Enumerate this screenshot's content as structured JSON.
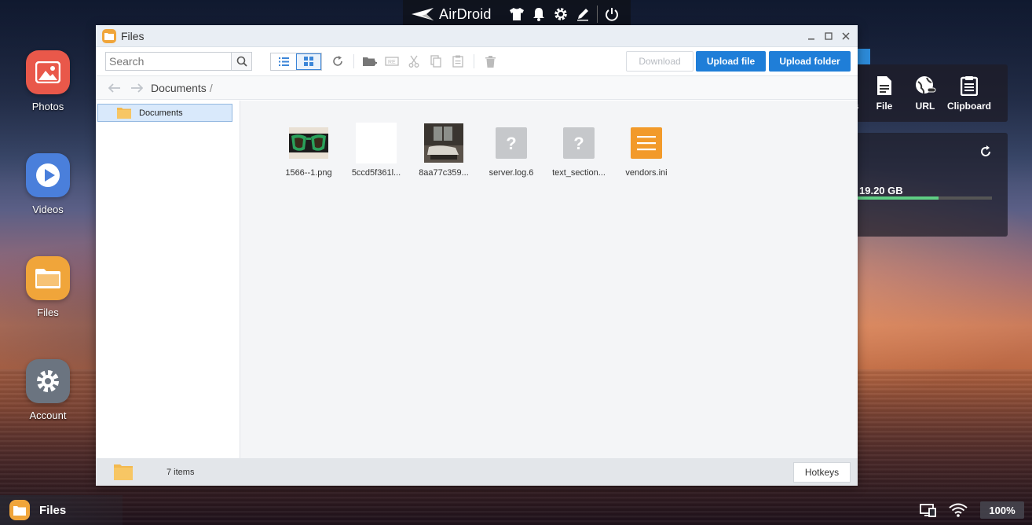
{
  "topbar": {
    "brand": "AirDroid",
    "icons": [
      "tshirt-icon",
      "bell-icon",
      "gear-icon",
      "pen-icon",
      "power-icon"
    ]
  },
  "desktop": {
    "icons": [
      {
        "label": "Photos",
        "icon": "photos-icon",
        "color": "#e9584a"
      },
      {
        "label": "Videos",
        "icon": "videos-icon",
        "color": "#4a7fdb"
      },
      {
        "label": "Files",
        "icon": "files-icon",
        "color": "#f0a53a"
      },
      {
        "label": "Account",
        "icon": "account-gear-icon",
        "color": "#6b7480"
      }
    ]
  },
  "right_widgets": {
    "toolbox": [
      {
        "label": "s"
      },
      {
        "label": "File"
      },
      {
        "label": "URL"
      },
      {
        "label": "Clipboard"
      }
    ],
    "storage": {
      "text": "19.20 GB",
      "used_fraction": 0.6
    }
  },
  "window": {
    "title": "Files",
    "search": {
      "placeholder": "Search",
      "value": ""
    },
    "buttons": {
      "download": "Download",
      "upload_file": "Upload file",
      "upload_folder": "Upload folder",
      "hotkeys": "Hotkeys"
    },
    "path": {
      "current": "Documents",
      "separator": "/"
    },
    "tree": {
      "items": [
        {
          "label": "Documents"
        }
      ]
    },
    "files": [
      {
        "name": "1566--1.png",
        "type": "image-glasses"
      },
      {
        "name": "5ccd5f361l...",
        "type": "image-blank"
      },
      {
        "name": "8aa77c359...",
        "type": "image-room"
      },
      {
        "name": "server.log.6",
        "type": "unknown"
      },
      {
        "name": "text_section...",
        "type": "unknown"
      },
      {
        "name": "vendors.ini",
        "type": "text"
      }
    ],
    "status": {
      "count": "7 items"
    }
  },
  "taskbar": {
    "active": "Files",
    "battery": "100%"
  },
  "colors": {
    "accent": "#1f7ed8",
    "folder": "#f0a53a"
  }
}
